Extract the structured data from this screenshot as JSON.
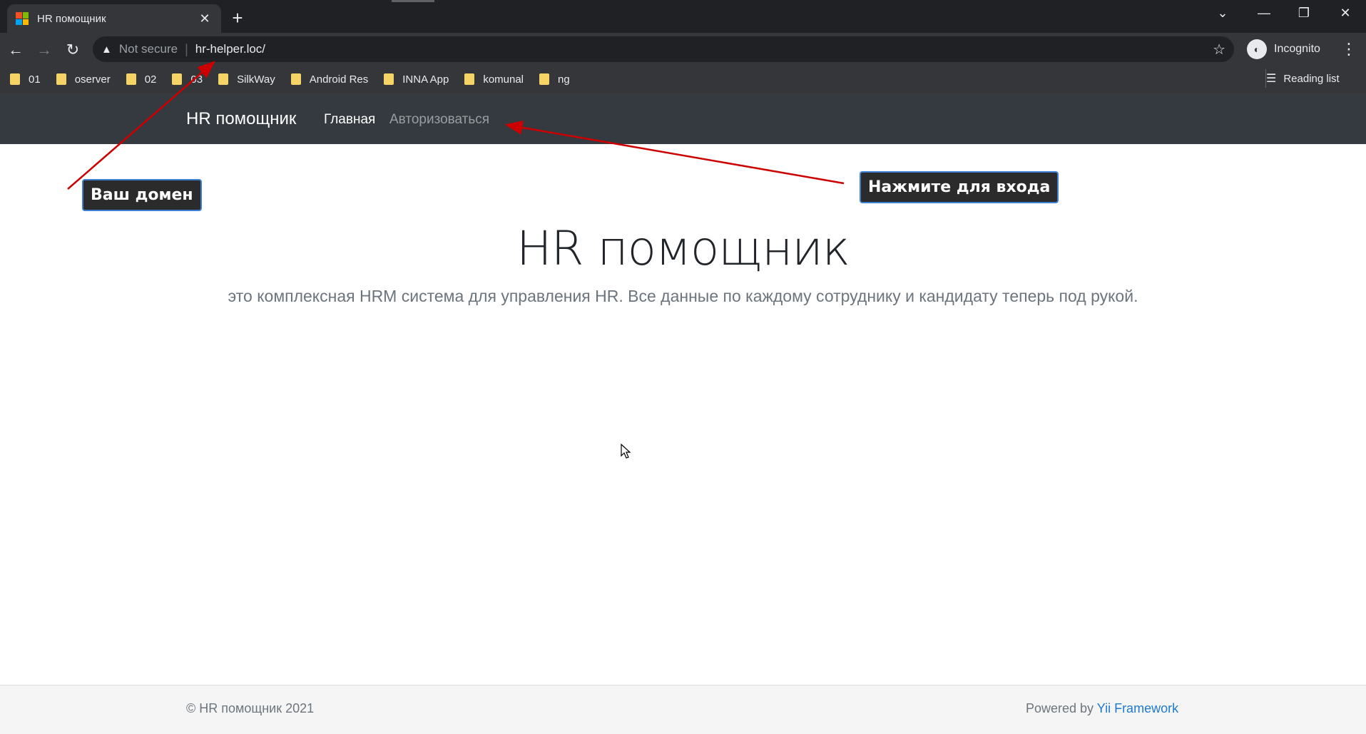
{
  "browser": {
    "tab_title": "HR помощник",
    "new_tab": "+",
    "not_secure": "Not secure",
    "url": "hr-helper.loc/",
    "profile": "Incognito",
    "bookmarks": [
      "01",
      "oserver",
      "02",
      "03",
      "SilkWay",
      "Android Res",
      "INNA App",
      "komunal",
      "ng"
    ],
    "reading_list": "Reading list"
  },
  "site": {
    "brand": "HR помощник",
    "nav_home": "Главная",
    "nav_login": "Авторизоваться",
    "title": "HR помощник",
    "lead": "это комплексная HRM система для управления HR. Все данные по каждому сотруднику и кандидату теперь под рукой.",
    "footer_copy": "© HR помощник 2021",
    "footer_powered": "Powered by ",
    "footer_framework": "Yii Framework"
  },
  "annotations": {
    "domain_note": "Ваш домен",
    "login_note": "Нажмите для входа",
    "color": "#cc0000"
  },
  "colors": {
    "navbar": "#343a40",
    "link": "#1e7ad1"
  }
}
